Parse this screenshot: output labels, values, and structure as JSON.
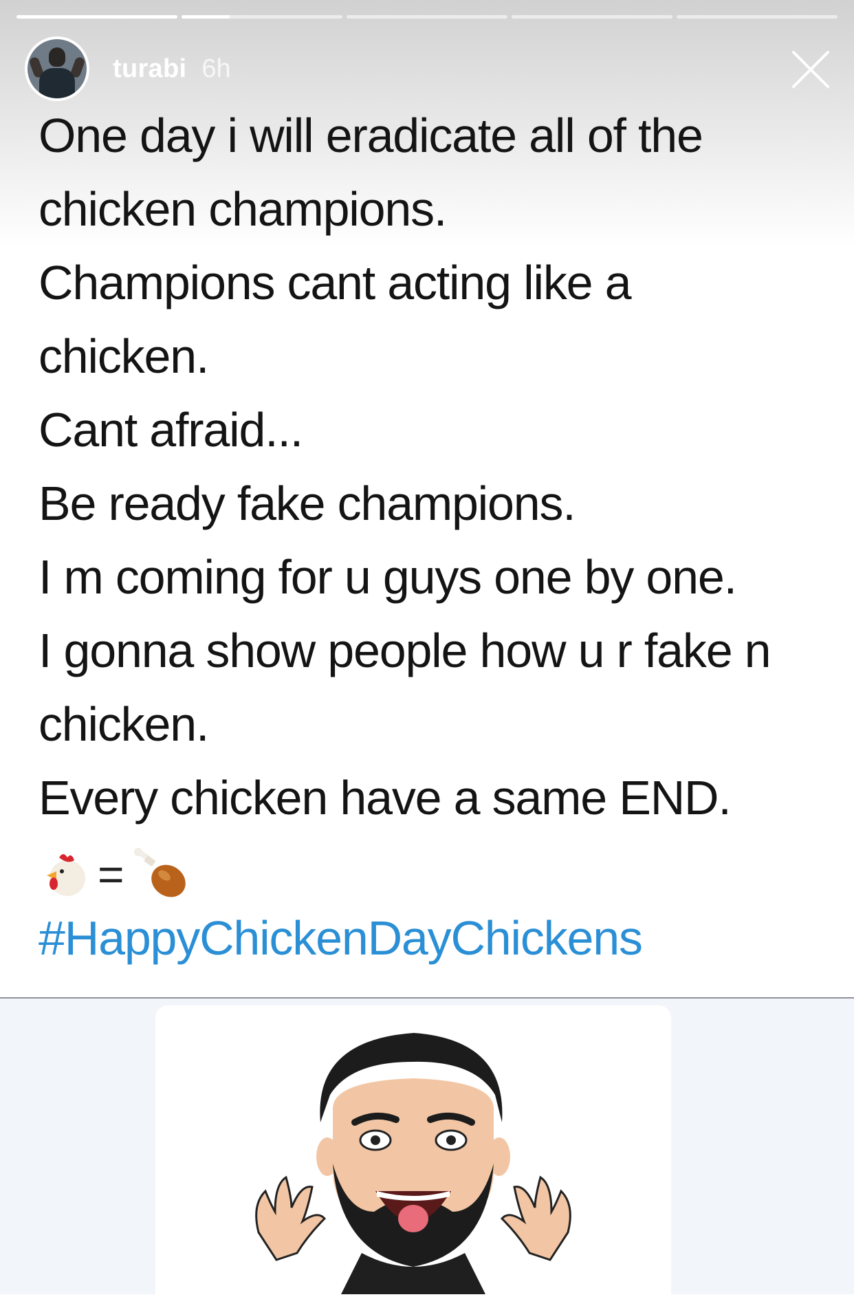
{
  "story": {
    "progress": [
      1.0,
      0.3,
      0,
      0,
      0
    ],
    "username": "turabi",
    "time": "6h"
  },
  "icons": {
    "close": "close-icon",
    "chicken": "chicken-emoji-icon",
    "drumstick": "drumstick-emoji-icon",
    "avatar": "user-avatar",
    "bitmoji": "bitmoji-character"
  },
  "tweet": {
    "lines": [
      "One day i will eradicate all of the",
      "chicken champions.",
      "Champions cant acting like a",
      "chicken.",
      "Cant afraid...",
      "Be ready fake champions.",
      "I m coming for u guys one by one.",
      "I gonna show people how u r fake n",
      "chicken.",
      "Every chicken have a same END."
    ],
    "equals": "=",
    "hashtag": "#HappyChickenDayChickens"
  },
  "colors": {
    "hashtag": "#2b8fd6",
    "text": "#141414",
    "lower_bg": "#f2f5fa"
  }
}
